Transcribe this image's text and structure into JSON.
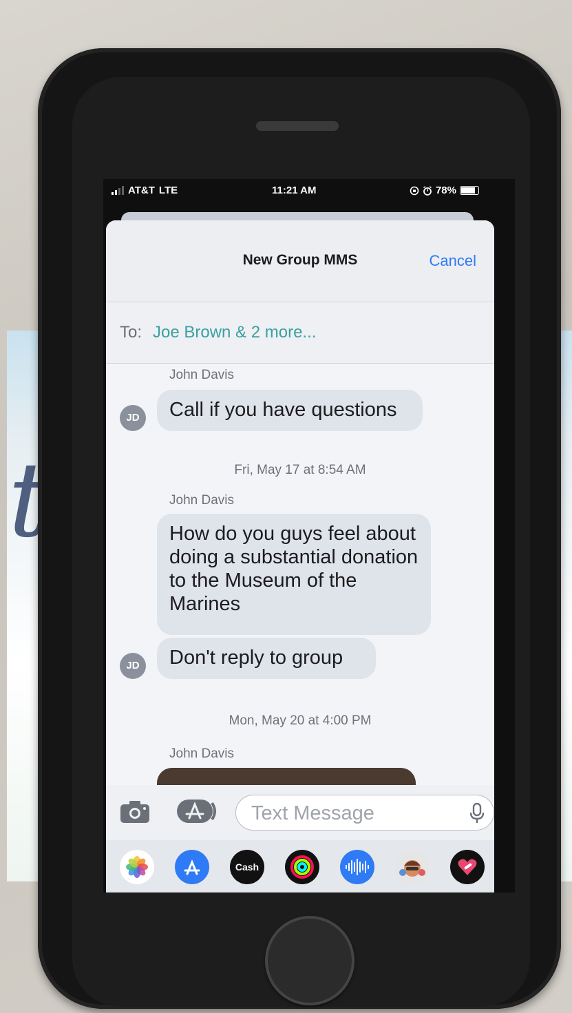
{
  "status_bar": {
    "carrier": "AT&T",
    "network": "LTE",
    "time": "11:21 AM",
    "battery": "78%"
  },
  "nav": {
    "title": "New Group MMS",
    "cancel_label": "Cancel"
  },
  "recipients": {
    "label": "To:",
    "value": "Joe  Brown  & 2 more..."
  },
  "thread": [
    {
      "sender": "John Davis",
      "avatar": "JD",
      "text": "Call if you have questions"
    },
    {
      "timestamp": "Fri, May 17 at 8:54 AM"
    },
    {
      "sender": "John Davis",
      "text": "How do you guys feel about doing a substantial donation to the Museum of the Marines"
    },
    {
      "avatar": "JD",
      "text": "Don't reply to group"
    },
    {
      "timestamp": "Mon, May 20 at 4:00 PM"
    },
    {
      "sender": "John Davis"
    }
  ],
  "composer": {
    "placeholder": "Text Message",
    "camera_icon": "camera-icon",
    "apps_icon": "app-store-icon",
    "mic_icon": "microphone-icon"
  },
  "app_drawer": [
    {
      "icon": "photos-icon"
    },
    {
      "icon": "app-store-icon"
    },
    {
      "icon": "apple-cash-icon",
      "label": "Cash"
    },
    {
      "icon": "activity-icon"
    },
    {
      "icon": "audio-message-icon"
    },
    {
      "icon": "memoji-icon"
    },
    {
      "icon": "digital-touch-icon"
    }
  ],
  "colors": {
    "accent": "#2f7bf5",
    "recipient": "#3aa0a0",
    "bubble": "#dfe3ea"
  }
}
